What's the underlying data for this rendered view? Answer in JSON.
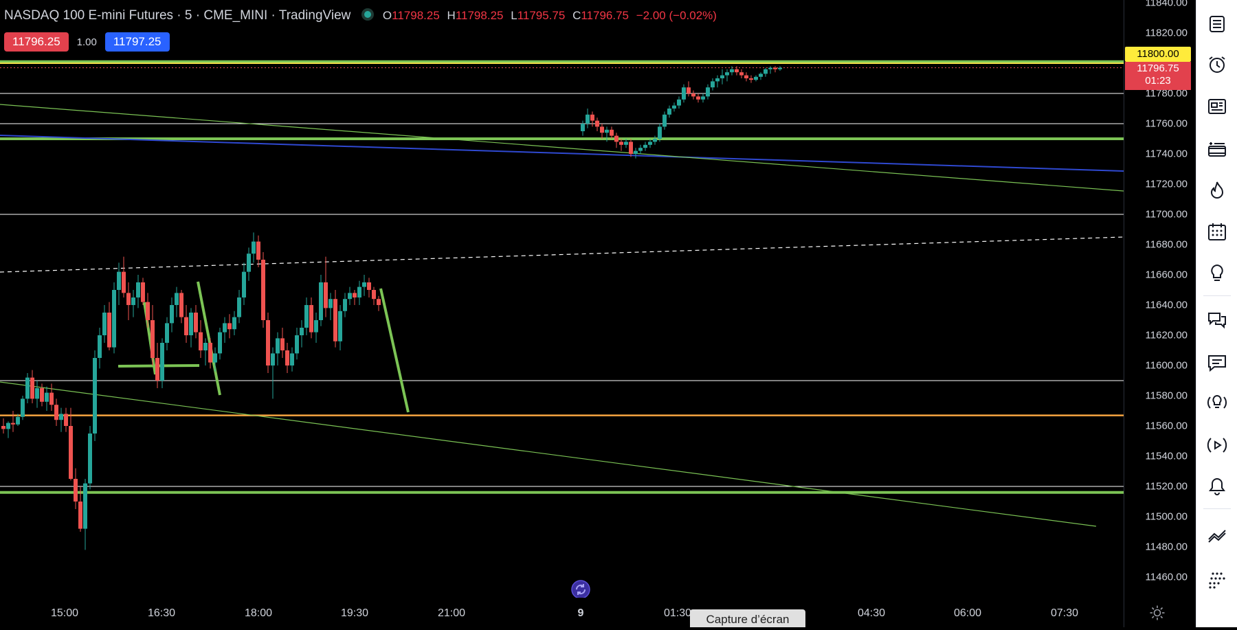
{
  "legend": {
    "symbol": "NASDAQ 100 E-mini Futures · 5 · CME_MINI · TradingView",
    "o_label": "O",
    "o": "11798.25",
    "h_label": "H",
    "h": "11798.25",
    "l_label": "L",
    "l": "11795.75",
    "c_label": "C",
    "c": "11796.75",
    "change": "−2.00 (−0.02%)"
  },
  "trade": {
    "sell": "11796.25",
    "qty": "1.00",
    "buy": "11797.25"
  },
  "price_axis": {
    "ticks": [
      "11840.00",
      "11820.00",
      "11780.00",
      "11760.00",
      "11740.00",
      "11720.00",
      "11700.00",
      "11680.00",
      "11660.00",
      "11640.00",
      "11620.00",
      "11600.00",
      "11580.00",
      "11560.00",
      "11540.00",
      "11520.00",
      "11500.00",
      "11480.00",
      "11460.00"
    ],
    "alert_price": "11800.00",
    "last_price": "11796.75",
    "countdown": "01:23"
  },
  "time_axis": [
    "15:00",
    "16:30",
    "18:00",
    "19:30",
    "21:00",
    "9",
    "01:30",
    "04:30",
    "06:00",
    "07:30"
  ],
  "screenshot_tooltip": "Capture d’écran",
  "toolbar_icons": [
    "watchlist-icon",
    "alarm-clock-icon",
    "news-icon",
    "add-list-icon",
    "hotlist-fire-icon",
    "calendar-icon",
    "idea-bulb-icon",
    "chats-icon",
    "messages-icon",
    "ideas-stream-icon",
    "broadcast-icon",
    "notifications-bell-icon",
    "trend-icon",
    "dots-grid-icon"
  ],
  "colors": {
    "up": "#26a69a",
    "down": "#ef5350",
    "green_line": "#7cc455",
    "blue_line": "#2f49d1",
    "orange_line": "#f7a541",
    "yellow_line": "#f5e14a"
  },
  "chart_data": {
    "type": "candlestick",
    "y_range": [
      11450,
      11840
    ],
    "series": [
      {
        "values": [
          [
            11560,
            11565,
            11555,
            11558
          ],
          [
            11558,
            11563,
            11552,
            11562
          ],
          [
            11562,
            11570,
            11556,
            11561
          ],
          [
            11561,
            11568,
            11560,
            11566
          ],
          [
            11566,
            11580,
            11564,
            11578
          ],
          [
            11578,
            11595,
            11575,
            11592
          ],
          [
            11592,
            11597,
            11575,
            11578
          ],
          [
            11578,
            11590,
            11572,
            11585
          ],
          [
            11585,
            11588,
            11573,
            11576
          ],
          [
            11576,
            11586,
            11570,
            11582
          ],
          [
            11582,
            11588,
            11570,
            11574
          ],
          [
            11574,
            11578,
            11560,
            11564
          ],
          [
            11564,
            11572,
            11556,
            11568
          ],
          [
            11568,
            11572,
            11556,
            11560
          ],
          [
            11560,
            11572,
            11524,
            11525
          ],
          [
            11525,
            11532,
            11505,
            11510
          ],
          [
            11510,
            11520,
            11490,
            11492
          ],
          [
            11492,
            11525,
            11478,
            11522
          ],
          [
            11522,
            11560,
            11518,
            11555
          ],
          [
            11555,
            11610,
            11550,
            11605
          ],
          [
            11605,
            11625,
            11598,
            11620
          ],
          [
            11620,
            11640,
            11615,
            11635
          ],
          [
            11635,
            11642,
            11610,
            11612
          ],
          [
            11612,
            11655,
            11608,
            11650
          ],
          [
            11650,
            11668,
            11640,
            11662
          ],
          [
            11662,
            11672,
            11645,
            11648
          ],
          [
            11648,
            11655,
            11630,
            11640
          ],
          [
            11640,
            11650,
            11632,
            11645
          ],
          [
            11645,
            11660,
            11638,
            11655
          ],
          [
            11655,
            11658,
            11640,
            11642
          ],
          [
            11642,
            11648,
            11625,
            11630
          ],
          [
            11630,
            11640,
            11600,
            11605
          ],
          [
            11605,
            11615,
            11585,
            11590
          ],
          [
            11590,
            11618,
            11585,
            11615
          ],
          [
            11615,
            11632,
            11610,
            11628
          ],
          [
            11628,
            11645,
            11622,
            11640
          ],
          [
            11640,
            11652,
            11632,
            11648
          ],
          [
            11648,
            11650,
            11628,
            11632
          ],
          [
            11632,
            11640,
            11615,
            11620
          ],
          [
            11620,
            11638,
            11612,
            11635
          ],
          [
            11635,
            11640,
            11618,
            11622
          ],
          [
            11622,
            11630,
            11605,
            11610
          ],
          [
            11610,
            11618,
            11600,
            11615
          ],
          [
            11615,
            11618,
            11598,
            11602
          ],
          [
            11602,
            11612,
            11596,
            11608
          ],
          [
            11608,
            11625,
            11604,
            11622
          ],
          [
            11622,
            11632,
            11615,
            11628
          ],
          [
            11628,
            11634,
            11618,
            11624
          ],
          [
            11624,
            11636,
            11620,
            11632
          ],
          [
            11632,
            11650,
            11628,
            11645
          ],
          [
            11645,
            11668,
            11640,
            11662
          ],
          [
            11662,
            11678,
            11656,
            11674
          ],
          [
            11674,
            11688,
            11668,
            11682
          ],
          [
            11682,
            11686,
            11665,
            11670
          ],
          [
            11670,
            11675,
            11625,
            11630
          ],
          [
            11630,
            11635,
            11595,
            11600
          ],
          [
            11600,
            11612,
            11578,
            11608
          ],
          [
            11608,
            11622,
            11600,
            11618
          ],
          [
            11618,
            11625,
            11605,
            11610
          ],
          [
            11610,
            11615,
            11595,
            11600
          ],
          [
            11600,
            11612,
            11596,
            11608
          ],
          [
            11608,
            11625,
            11604,
            11620
          ],
          [
            11620,
            11630,
            11612,
            11625
          ],
          [
            11625,
            11645,
            11620,
            11640
          ],
          [
            11640,
            11645,
            11618,
            11622
          ],
          [
            11622,
            11635,
            11615,
            11630
          ],
          [
            11630,
            11660,
            11626,
            11655
          ],
          [
            11655,
            11672,
            11632,
            11638
          ],
          [
            11638,
            11648,
            11630,
            11644
          ],
          [
            11644,
            11650,
            11612,
            11616
          ],
          [
            11616,
            11640,
            11610,
            11636
          ],
          [
            11636,
            11648,
            11632,
            11644
          ],
          [
            11644,
            11652,
            11640,
            11648
          ],
          [
            11648,
            11650,
            11640,
            11645
          ],
          [
            11645,
            11656,
            11640,
            11652
          ],
          [
            11652,
            11660,
            11646,
            11655
          ],
          [
            11655,
            11658,
            11645,
            11650
          ],
          [
            11650,
            11652,
            11640,
            11644
          ],
          [
            11644,
            11646,
            11636,
            11640
          ]
        ]
      },
      {
        "values": [
          [
            11755,
            11762,
            11752,
            11760
          ],
          [
            11760,
            11770,
            11757,
            11766
          ],
          [
            11766,
            11768,
            11758,
            11762
          ],
          [
            11762,
            11764,
            11755,
            11758
          ],
          [
            11758,
            11760,
            11750,
            11754
          ],
          [
            11754,
            11758,
            11748,
            11756
          ],
          [
            11756,
            11758,
            11750,
            11752
          ],
          [
            11752,
            11754,
            11744,
            11748
          ],
          [
            11748,
            11750,
            11742,
            11746
          ],
          [
            11746,
            11750,
            11744,
            11748
          ],
          [
            11748,
            11750,
            11738,
            11740
          ],
          [
            11740,
            11744,
            11737,
            11742
          ],
          [
            11742,
            11746,
            11740,
            11744
          ],
          [
            11744,
            11748,
            11742,
            11746
          ],
          [
            11746,
            11750,
            11744,
            11748
          ],
          [
            11748,
            11752,
            11746,
            11750
          ],
          [
            11750,
            11760,
            11748,
            11758
          ],
          [
            11758,
            11768,
            11756,
            11766
          ],
          [
            11766,
            11772,
            11764,
            11770
          ],
          [
            11770,
            11774,
            11768,
            11772
          ],
          [
            11772,
            11778,
            11770,
            11776
          ],
          [
            11776,
            11786,
            11774,
            11784
          ],
          [
            11784,
            11788,
            11778,
            11780
          ],
          [
            11780,
            11782,
            11776,
            11778
          ],
          [
            11778,
            11780,
            11774,
            11776
          ],
          [
            11776,
            11780,
            11774,
            11778
          ],
          [
            11778,
            11786,
            11776,
            11784
          ],
          [
            11784,
            11790,
            11782,
            11788
          ],
          [
            11788,
            11792,
            11784,
            11790
          ],
          [
            11790,
            11796,
            11786,
            11792
          ],
          [
            11792,
            11796,
            11788,
            11794
          ],
          [
            11794,
            11798,
            11792,
            11796
          ],
          [
            11796,
            11798,
            11792,
            11794
          ],
          [
            11794,
            11796,
            11790,
            11792
          ],
          [
            11792,
            11794,
            11788,
            11790
          ],
          [
            11790,
            11792,
            11787,
            11789
          ],
          [
            11789,
            11792,
            11788,
            11791
          ],
          [
            11791,
            11794,
            11789,
            11793
          ],
          [
            11793,
            11797,
            11791,
            11796
          ],
          [
            11796,
            11798,
            11793,
            11797
          ],
          [
            11797,
            11798,
            11794,
            11796
          ],
          [
            11796,
            11798,
            11795,
            11797
          ]
        ]
      }
    ]
  }
}
